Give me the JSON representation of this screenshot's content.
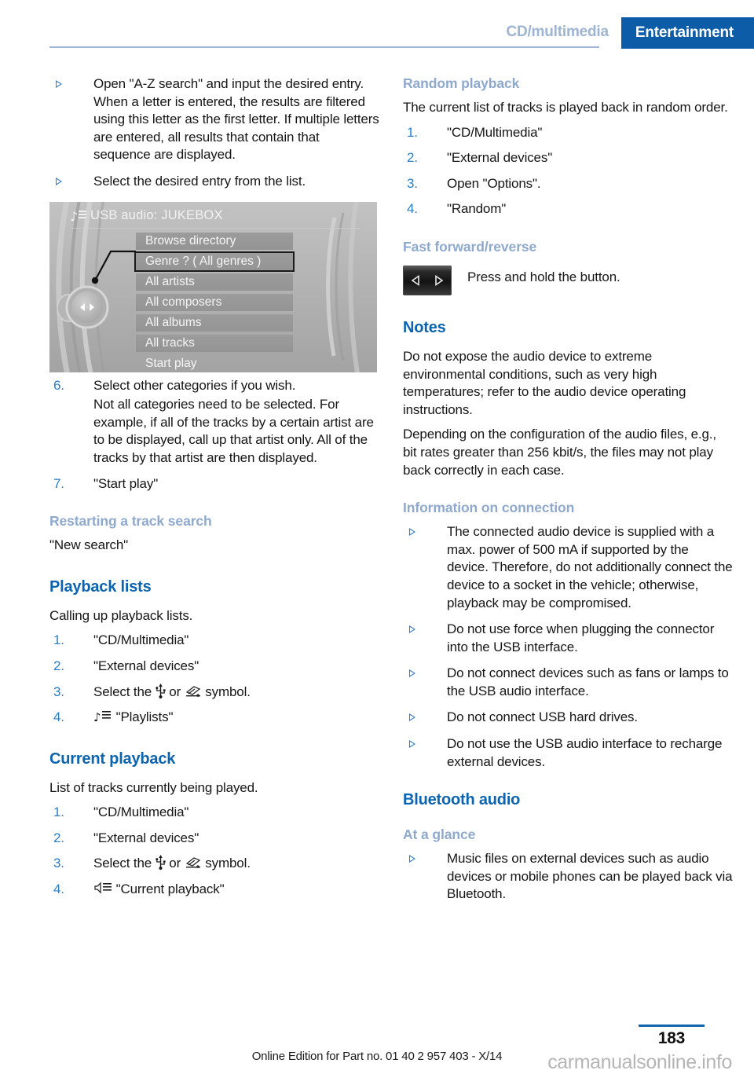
{
  "header": {
    "inactive_tab": "CD/multimedia",
    "active_tab": "Entertainment",
    "accent_color": "#0c5ca8",
    "muted_color": "#9db4d2"
  },
  "left_column": {
    "top_bullets": [
      "Open \"A-Z search\" and input the desired entry. When a letter is entered, the results are filtered using this letter as the first letter. If multiple letters are entered, all results that contain that sequence are displayed.",
      "Select the desired entry from the list."
    ],
    "screenshot": {
      "title": "USB audio: JUKEBOX",
      "title_icon": "music-note-icon",
      "rows": [
        {
          "label": "Browse directory",
          "selected": false,
          "plain": false
        },
        {
          "label": "Genre ? ( All genres )",
          "selected": true,
          "plain": false
        },
        {
          "label": "All artists",
          "selected": false,
          "plain": false
        },
        {
          "label": "All composers",
          "selected": false,
          "plain": false
        },
        {
          "label": "All albums",
          "selected": false,
          "plain": false
        },
        {
          "label": "All tracks",
          "selected": false,
          "plain": false
        },
        {
          "label": "Start play",
          "selected": false,
          "plain": true
        }
      ],
      "controller_icon": "idrive-controller-icon"
    },
    "steps_6_7": [
      {
        "num": "6.",
        "text": "Select other categories if you wish.",
        "sub": "Not all categories need to be selected. For example, if all of the tracks by a certain artist are to be displayed, call up that artist only. All of the tracks by that artist are then displayed."
      },
      {
        "num": "7.",
        "text": "\"Start play\"",
        "sub": ""
      }
    ],
    "restarting_heading": "Restarting a track search",
    "restarting_text": "\"New search\"",
    "playback_lists_heading": "Playback lists",
    "playback_lists_intro": "Calling up playback lists.",
    "playback_lists_steps": [
      {
        "num": "1.",
        "text": "\"CD/Multimedia\""
      },
      {
        "num": "2.",
        "text": "\"External devices\""
      },
      {
        "num": "3.",
        "text_before": "Select the",
        "icon1": "usb-icon",
        "text_mid": "or",
        "icon2": "external-device-icon",
        "text_after": "symbol."
      },
      {
        "num": "4.",
        "icon": "playlist-icon",
        "text": "\"Playlists\""
      }
    ],
    "current_playback_heading": "Current playback",
    "current_playback_intro": "List of tracks currently being played.",
    "current_playback_steps": [
      {
        "num": "1.",
        "text": "\"CD/Multimedia\""
      },
      {
        "num": "2.",
        "text": "\"External devices\""
      },
      {
        "num": "3.",
        "text_before": "Select the",
        "icon1": "usb-icon",
        "text_mid": "or",
        "icon2": "external-device-icon",
        "text_after": "symbol."
      },
      {
        "num": "4.",
        "icon": "current-playback-icon",
        "text": "\"Current playback\""
      }
    ]
  },
  "right_column": {
    "random_heading": "Random playback",
    "random_text": "The current list of tracks is played back in random order.",
    "random_steps": [
      {
        "num": "1.",
        "text": "\"CD/Multimedia\""
      },
      {
        "num": "2.",
        "text": "\"External devices\""
      },
      {
        "num": "3.",
        "text": "Open \"Options\"."
      },
      {
        "num": "4.",
        "text": "\"Random\""
      }
    ],
    "ff_heading": "Fast forward/reverse",
    "ff_text": "Press and hold the button.",
    "ff_button_icon": "rocker-button-icon",
    "notes_heading": "Notes",
    "notes_paragraphs": [
      "Do not expose the audio device to extreme environmental conditions, such as very high temperatures; refer to the audio device operating instructions.",
      "Depending on the configuration of the audio files, e.g., bit rates greater than 256 kbit/s, the files may not play back correctly in each case."
    ],
    "connection_heading": "Information on connection",
    "connection_bullets": [
      "The connected audio device is supplied with a max. power of 500 mA if supported by the device. Therefore, do not additionally connect the device to a socket in the vehicle; otherwise, playback may be compromised.",
      "Do not use force when plugging the connector into the USB interface.",
      "Do not connect devices such as fans or lamps to the USB audio interface.",
      "Do not connect USB hard drives.",
      "Do not use the USB audio interface to recharge external devices."
    ],
    "bluetooth_heading": "Bluetooth audio",
    "at_a_glance_heading": "At a glance",
    "at_a_glance_bullets": [
      "Music files on external devices such as audio devices or mobile phones can be played back via Bluetooth."
    ]
  },
  "footer": {
    "edition_text": "Online Edition for Part no. 01 40 2 957 403 - X/14",
    "page_number": "183",
    "watermark": "carmanualsonline.info"
  }
}
